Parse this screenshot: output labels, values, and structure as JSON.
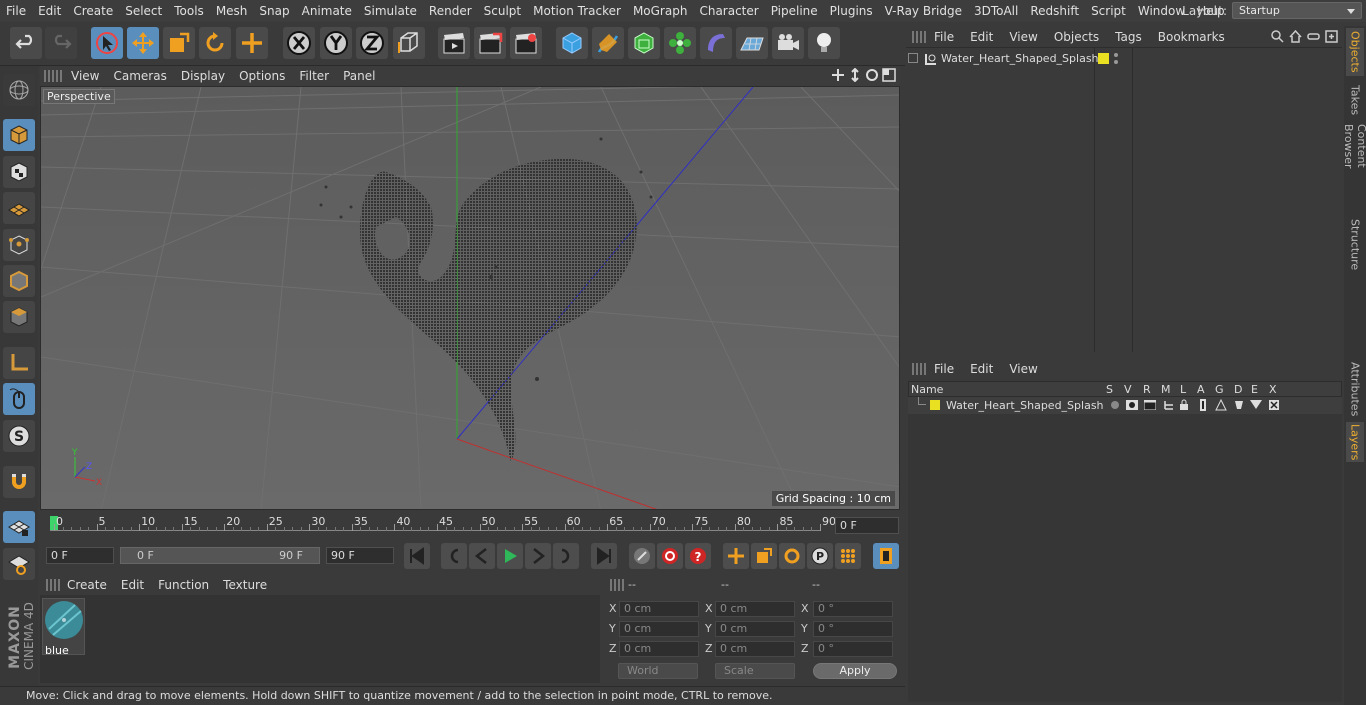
{
  "menubar": {
    "items": [
      "File",
      "Edit",
      "Create",
      "Select",
      "Tools",
      "Mesh",
      "Snap",
      "Animate",
      "Simulate",
      "Render",
      "Sculpt",
      "Motion Tracker",
      "MoGraph",
      "Character",
      "Pipeline",
      "Plugins",
      "V-Ray Bridge",
      "3DToAll",
      "Redshift",
      "Script",
      "Window",
      "Help"
    ],
    "layout_label": "Layout:",
    "layout_value": "Startup"
  },
  "viewport": {
    "menu": [
      "View",
      "Cameras",
      "Display",
      "Options",
      "Filter",
      "Panel"
    ],
    "label": "Perspective",
    "grid_spacing": "Grid Spacing : 10 cm"
  },
  "timeline": {
    "ticks": [
      "0",
      "5",
      "10",
      "15",
      "20",
      "25",
      "30",
      "35",
      "40",
      "45",
      "50",
      "55",
      "60",
      "65",
      "70",
      "75",
      "80",
      "85",
      "90"
    ],
    "current_frame": "0 F",
    "start_frame": "0 F",
    "range_start": "0 F",
    "range_end": "90 F",
    "end_frame": "90 F"
  },
  "material": {
    "menu": [
      "Create",
      "Edit",
      "Function",
      "Texture"
    ],
    "name": "blue"
  },
  "coords": {
    "headers": [
      "--",
      "--",
      "--"
    ],
    "rows": [
      {
        "axis": "X",
        "pos": "0 cm",
        "size": "0 cm",
        "rot": "0 °"
      },
      {
        "axis": "Y",
        "pos": "0 cm",
        "size": "0 cm",
        "rot": "0 °"
      },
      {
        "axis": "Z",
        "pos": "0 cm",
        "size": "0 cm",
        "rot": "0 °"
      }
    ],
    "mode1": "World",
    "mode2": "Scale",
    "apply": "Apply",
    "labels": [
      "X",
      "Y",
      "Z"
    ]
  },
  "status": "Move: Click and drag to move elements. Hold down SHIFT to quantize movement / add to the selection in point mode, CTRL to remove.",
  "objects": {
    "menu": [
      "File",
      "Edit",
      "View",
      "Objects",
      "Tags",
      "Bookmarks"
    ],
    "item": "Water_Heart_Shaped_Splash"
  },
  "layers": {
    "menu": [
      "File",
      "Edit",
      "View"
    ],
    "columns": [
      "Name",
      "S",
      "V",
      "R",
      "M",
      "L",
      "A",
      "G",
      "D",
      "E",
      "X"
    ],
    "item": "Water_Heart_Shaped_Splash"
  },
  "sidetabs": [
    "Objects",
    "Takes",
    "Content Browser",
    "Structure",
    "Attributes",
    "Layers"
  ],
  "brand": {
    "line1": "MAXON",
    "line2": "CINEMA 4D"
  },
  "colors": {
    "accent": "#5a8fbd",
    "layer_yellow": "#e8e020"
  }
}
